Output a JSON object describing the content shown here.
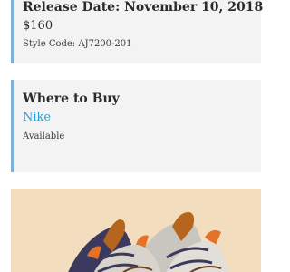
{
  "release": {
    "title": "Release Date: November 10, 2018",
    "price": "$160",
    "style_code": "Style Code: AJ7200-201"
  },
  "where_to_buy": {
    "title": "Where to Buy",
    "retailer": "Nike",
    "status": "Available"
  },
  "product_image": {
    "subject": "sneaker-photo",
    "background_color": "#f2ddbf",
    "colors": [
      "#b5651d",
      "#e4732a",
      "#3b3a5e",
      "#c9c6c0",
      "#6b3e1f"
    ]
  },
  "colors": {
    "accent": "#7fb2d6",
    "link": "#2a9fd1",
    "card_background": "#f3f3f3"
  }
}
